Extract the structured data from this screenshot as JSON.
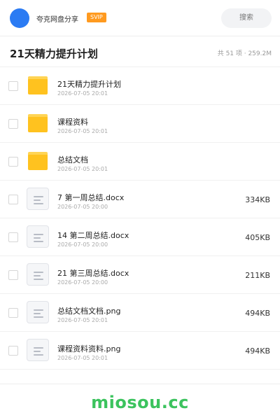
{
  "header": {
    "owner_name": "夸克网盘分享",
    "vip_label": "SVIP",
    "search_placeholder": "搜索"
  },
  "folder": {
    "title": "21天精力提升计划",
    "summary": "共 51 项 · 259.2M"
  },
  "files": [
    {
      "type": "folder",
      "name": "21天精力提升计划",
      "date": "2026-07-05 20:01",
      "size": ""
    },
    {
      "type": "folder",
      "name": "课程资料",
      "date": "2026-07-05 20:01",
      "size": ""
    },
    {
      "type": "folder",
      "name": "总结文档",
      "date": "2026-07-05 20:01",
      "size": ""
    },
    {
      "type": "doc",
      "name": "7 第一周总结.docx",
      "date": "2026-07-05 20:00",
      "size": "334KB"
    },
    {
      "type": "doc",
      "name": "14 第二周总结.docx",
      "date": "2026-07-05 20:00",
      "size": "405KB"
    },
    {
      "type": "doc",
      "name": "21 第三周总结.docx",
      "date": "2026-07-05 20:00",
      "size": "211KB"
    },
    {
      "type": "doc",
      "name": "总结文档文档.png",
      "date": "2026-07-05 20:01",
      "size": "494KB"
    },
    {
      "type": "doc",
      "name": "课程资料资料.png",
      "date": "2026-07-05 20:01",
      "size": "494KB"
    }
  ],
  "footer": {
    "watermark": "miosou.cc"
  },
  "colors": {
    "avatar": "#2b7bf3",
    "vip": "#ff9a1f",
    "folder": "#ffc21f",
    "watermark": "#3cc35e"
  }
}
